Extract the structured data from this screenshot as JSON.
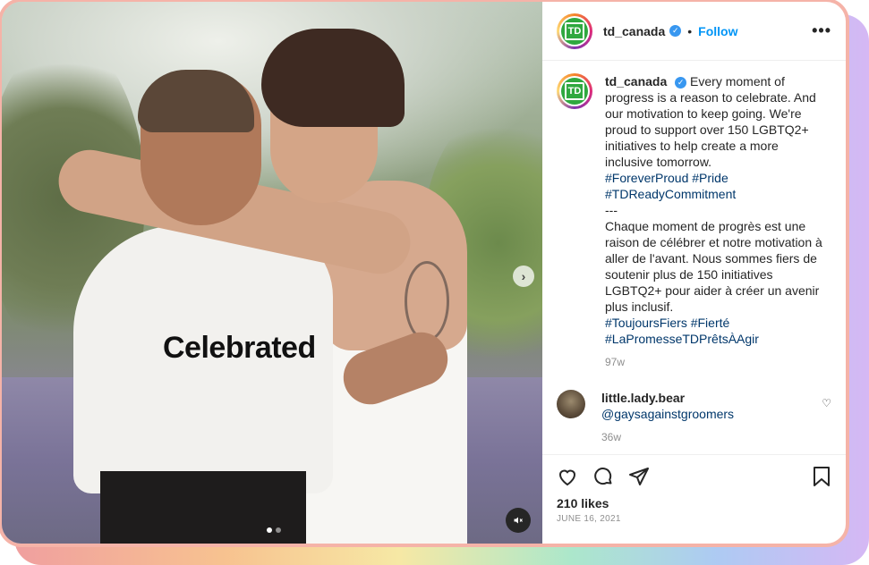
{
  "post": {
    "overlay_text": "Celebrated",
    "media_next_label": "›",
    "mute_label": "🔇"
  },
  "header": {
    "logo_text": "TD",
    "username": "td_canada",
    "verified_mark": "✓",
    "separator": "•",
    "follow_label": "Follow",
    "more_label": "•••"
  },
  "caption": {
    "username": "td_canada",
    "en_text": "Every moment of progress is a reason to celebrate. And our motivation to keep going. We're proud to support over 150 LGBTQ2+ initiatives to help create a more inclusive tomorrow.",
    "en_tags": "#ForeverProud #Pride #TDReadyCommitment",
    "divider": "---",
    "fr_text": "Chaque moment de progrès est une raison de célébrer et notre motivation à aller de l'avant. Nous sommes fiers de soutenir plus de 150 initiatives LGBTQ2+ pour aider à créer un avenir plus inclusif.",
    "fr_tags": "#ToujoursFiers #Fierté #LaPromesseTDPrêtsÀAgir",
    "time_ago": "97w"
  },
  "comment": {
    "username": "little.lady.bear",
    "text": "@gaysagainstgroomers",
    "time_ago": "36w",
    "heart_icon": "♡"
  },
  "actions": {
    "likes": "210 likes",
    "date": "JUNE 16, 2021"
  },
  "colors": {
    "accent": "#0095f6",
    "td_green": "#2fa83f",
    "hashtag": "#00376b"
  }
}
